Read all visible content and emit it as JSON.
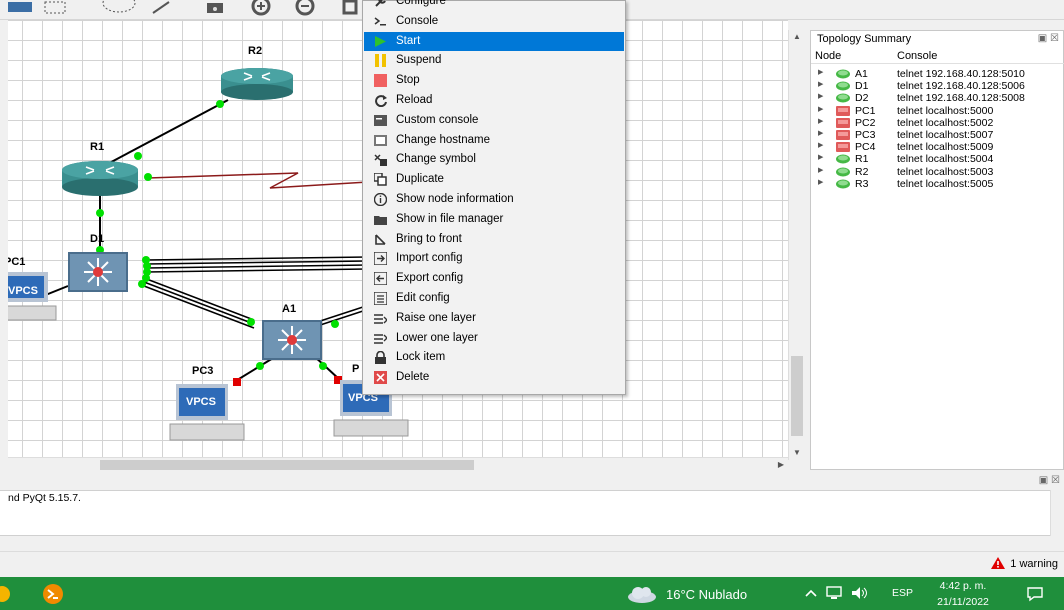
{
  "context_menu": {
    "items": [
      {
        "label": "Configure",
        "icon": "wrench-icon"
      },
      {
        "label": "Console",
        "icon": "terminal-icon"
      },
      {
        "label": "Start",
        "icon": "play-icon",
        "highlighted": true
      },
      {
        "label": "Suspend",
        "icon": "pause-icon"
      },
      {
        "label": "Stop",
        "icon": "stop-icon"
      },
      {
        "label": "Reload",
        "icon": "reload-icon"
      },
      {
        "label": "Custom console",
        "icon": "custom-console-icon"
      },
      {
        "label": "Change hostname",
        "icon": "hostname-icon"
      },
      {
        "label": "Change symbol",
        "icon": "symbol-icon"
      },
      {
        "label": "Duplicate",
        "icon": "duplicate-icon"
      },
      {
        "label": "Show node information",
        "icon": "info-icon"
      },
      {
        "label": "Show in file manager",
        "icon": "folder-icon"
      },
      {
        "label": "Bring to front",
        "icon": "bring-front-icon"
      },
      {
        "label": "Import config",
        "icon": "import-icon"
      },
      {
        "label": "Export config",
        "icon": "export-icon"
      },
      {
        "label": "Edit config",
        "icon": "edit-config-icon"
      },
      {
        "label": "Raise one layer",
        "icon": "raise-layer-icon"
      },
      {
        "label": "Lower one layer",
        "icon": "lower-layer-icon"
      },
      {
        "label": "Lock item",
        "icon": "lock-icon"
      },
      {
        "label": "Delete",
        "icon": "delete-icon"
      }
    ]
  },
  "canvas": {
    "labels": {
      "r2": "R2",
      "r1": "R1",
      "d1": "D1",
      "pc1": "PC1",
      "a1": "A1",
      "pc3": "PC3",
      "pc_partial": "P",
      "vpcs": "VPCS"
    }
  },
  "topology_summary": {
    "title": "Topology Summary",
    "columns": {
      "node": "Node",
      "console": "Console"
    },
    "rows": [
      {
        "node": "A1",
        "console": "telnet 192.168.40.128:5010",
        "kind": "switch"
      },
      {
        "node": "D1",
        "console": "telnet 192.168.40.128:5006",
        "kind": "switch"
      },
      {
        "node": "D2",
        "console": "telnet 192.168.40.128:5008",
        "kind": "switch"
      },
      {
        "node": "PC1",
        "console": "telnet localhost:5000",
        "kind": "pc"
      },
      {
        "node": "PC2",
        "console": "telnet localhost:5002",
        "kind": "pc"
      },
      {
        "node": "PC3",
        "console": "telnet localhost:5007",
        "kind": "pc"
      },
      {
        "node": "PC4",
        "console": "telnet localhost:5009",
        "kind": "pc"
      },
      {
        "node": "R1",
        "console": "telnet localhost:5004",
        "kind": "router"
      },
      {
        "node": "R2",
        "console": "telnet localhost:5003",
        "kind": "router"
      },
      {
        "node": "R3",
        "console": "telnet localhost:5005",
        "kind": "router"
      }
    ]
  },
  "console": {
    "text": "nd PyQt 5.15.7."
  },
  "status": {
    "warning": "1 warning"
  },
  "taskbar": {
    "weather": "16°C  Nublado",
    "language": "ESP",
    "time": "4:42 p. m.",
    "date": "21/11/2022"
  },
  "colors": {
    "highlight": "#0078d7",
    "taskbar": "#1f8f3c",
    "link_ok": "#00e000",
    "link_down": "#e00000",
    "router": "#3a8f8f"
  }
}
